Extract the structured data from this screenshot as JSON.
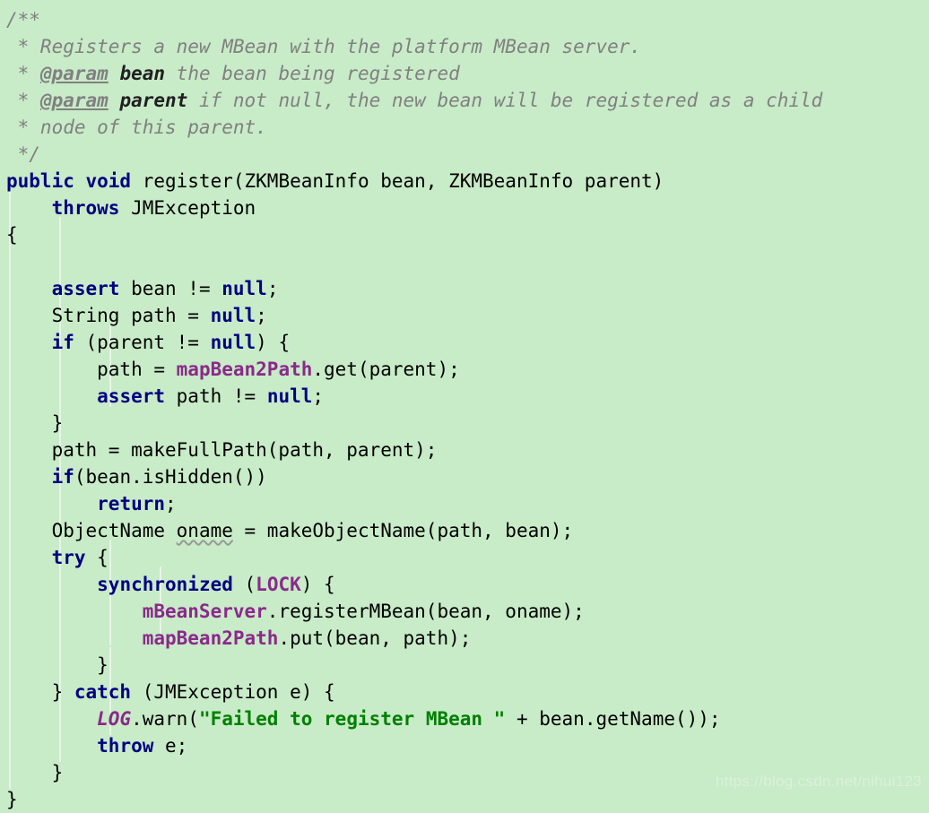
{
  "editor": {
    "background_color": "#c8ebc8",
    "language": "java",
    "indent_guide_color": "#e8f4e8",
    "colors": {
      "keyword": "#000080",
      "field": "#8a2a8a",
      "static_field": "#8a2a8a",
      "string": "#008000",
      "comment": "#808080",
      "javadoc_tag": "#808080",
      "plain_text": "#000000",
      "spellcheck_squiggle": "#9a9a9a"
    },
    "indent_guides_x": [
      10,
      66,
      122,
      178
    ],
    "line_count": 24
  },
  "watermark": {
    "text": "https://blog.csdn.net/nihui123"
  },
  "code": {
    "lines": [
      {
        "n": 1,
        "segments": [
          {
            "t": "cmt",
            "v": "/**"
          }
        ]
      },
      {
        "n": 2,
        "segments": [
          {
            "t": "cmt",
            "v": " * Registers a new MBean with the platform MBean server."
          }
        ]
      },
      {
        "n": 3,
        "segments": [
          {
            "t": "cmt",
            "v": " * "
          },
          {
            "t": "tag",
            "v": "@param"
          },
          {
            "t": "cmt",
            "v": " "
          },
          {
            "t": "pnm",
            "v": "bean"
          },
          {
            "t": "cmt",
            "v": " the bean being registered"
          }
        ]
      },
      {
        "n": 4,
        "segments": [
          {
            "t": "cmt",
            "v": " * "
          },
          {
            "t": "tag",
            "v": "@param"
          },
          {
            "t": "cmt",
            "v": " "
          },
          {
            "t": "pnm",
            "v": "parent"
          },
          {
            "t": "cmt",
            "v": " if not null, the new bean will be registered as a child"
          }
        ]
      },
      {
        "n": 5,
        "segments": [
          {
            "t": "cmt",
            "v": " * node of this parent."
          }
        ]
      },
      {
        "n": 6,
        "segments": [
          {
            "t": "cmt",
            "v": " */"
          }
        ]
      },
      {
        "n": 7,
        "segments": [
          {
            "t": "kw",
            "v": "public void"
          },
          {
            "t": "plain",
            "v": " register(ZKMBeanInfo bean, ZKMBeanInfo parent)"
          }
        ]
      },
      {
        "n": 8,
        "segments": [
          {
            "t": "plain",
            "v": "    "
          },
          {
            "t": "kw",
            "v": "throws"
          },
          {
            "t": "plain",
            "v": " JMException"
          }
        ]
      },
      {
        "n": 9,
        "segments": [
          {
            "t": "plain",
            "v": "{"
          }
        ]
      },
      {
        "n": 10,
        "segments": [
          {
            "t": "plain",
            "v": ""
          }
        ]
      },
      {
        "n": 11,
        "segments": [
          {
            "t": "plain",
            "v": "    "
          },
          {
            "t": "kw",
            "v": "assert"
          },
          {
            "t": "plain",
            "v": " bean != "
          },
          {
            "t": "kw",
            "v": "null"
          },
          {
            "t": "plain",
            "v": ";"
          }
        ]
      },
      {
        "n": 12,
        "segments": [
          {
            "t": "plain",
            "v": "    String path = "
          },
          {
            "t": "kw",
            "v": "null"
          },
          {
            "t": "plain",
            "v": ";"
          }
        ]
      },
      {
        "n": 13,
        "segments": [
          {
            "t": "plain",
            "v": "    "
          },
          {
            "t": "kw",
            "v": "if"
          },
          {
            "t": "plain",
            "v": " (parent != "
          },
          {
            "t": "kw",
            "v": "null"
          },
          {
            "t": "plain",
            "v": ") {"
          }
        ]
      },
      {
        "n": 14,
        "segments": [
          {
            "t": "plain",
            "v": "        path = "
          },
          {
            "t": "fld",
            "v": "mapBean2Path"
          },
          {
            "t": "plain",
            "v": ".get(parent);"
          }
        ]
      },
      {
        "n": 15,
        "segments": [
          {
            "t": "plain",
            "v": "        "
          },
          {
            "t": "kw",
            "v": "assert"
          },
          {
            "t": "plain",
            "v": " path != "
          },
          {
            "t": "kw",
            "v": "null"
          },
          {
            "t": "plain",
            "v": ";"
          }
        ]
      },
      {
        "n": 16,
        "segments": [
          {
            "t": "plain",
            "v": "    }"
          }
        ]
      },
      {
        "n": 17,
        "segments": [
          {
            "t": "plain",
            "v": "    path = makeFullPath(path, parent);"
          }
        ]
      },
      {
        "n": 18,
        "segments": [
          {
            "t": "plain",
            "v": "    "
          },
          {
            "t": "kw",
            "v": "if"
          },
          {
            "t": "plain",
            "v": "(bean.isHidden())"
          }
        ]
      },
      {
        "n": 19,
        "segments": [
          {
            "t": "plain",
            "v": "        "
          },
          {
            "t": "kw",
            "v": "return"
          },
          {
            "t": "plain",
            "v": ";"
          }
        ]
      },
      {
        "n": 20,
        "segments": [
          {
            "t": "plain",
            "v": "    ObjectName "
          },
          {
            "t": "squig",
            "v": "oname"
          },
          {
            "t": "plain",
            "v": " = makeObjectName(path, bean);"
          }
        ]
      },
      {
        "n": 21,
        "segments": [
          {
            "t": "plain",
            "v": "    "
          },
          {
            "t": "kw",
            "v": "try"
          },
          {
            "t": "plain",
            "v": " {"
          }
        ]
      },
      {
        "n": 22,
        "segments": [
          {
            "t": "plain",
            "v": "        "
          },
          {
            "t": "kw",
            "v": "synchronized"
          },
          {
            "t": "plain",
            "v": " ("
          },
          {
            "t": "fld",
            "v": "LOCK"
          },
          {
            "t": "plain",
            "v": ") {"
          }
        ]
      },
      {
        "n": 23,
        "segments": [
          {
            "t": "plain",
            "v": "            "
          },
          {
            "t": "fld",
            "v": "mBeanServer"
          },
          {
            "t": "plain",
            "v": ".registerMBean(bean, oname);"
          }
        ]
      },
      {
        "n": 24,
        "segments": [
          {
            "t": "plain",
            "v": "            "
          },
          {
            "t": "fld",
            "v": "mapBean2Path"
          },
          {
            "t": "plain",
            "v": ".put(bean, path);"
          }
        ]
      },
      {
        "n": 25,
        "segments": [
          {
            "t": "plain",
            "v": "        }"
          }
        ]
      },
      {
        "n": 26,
        "segments": [
          {
            "t": "plain",
            "v": "    } "
          },
          {
            "t": "kw",
            "v": "catch"
          },
          {
            "t": "plain",
            "v": " (JMException e) {"
          }
        ]
      },
      {
        "n": 27,
        "segments": [
          {
            "t": "plain",
            "v": "        "
          },
          {
            "t": "stat",
            "v": "LOG"
          },
          {
            "t": "plain",
            "v": ".warn("
          },
          {
            "t": "str",
            "v": "\"Failed to register MBean \""
          },
          {
            "t": "plain",
            "v": " + bean.getName());"
          }
        ]
      },
      {
        "n": 28,
        "segments": [
          {
            "t": "plain",
            "v": "        "
          },
          {
            "t": "kw",
            "v": "throw"
          },
          {
            "t": "plain",
            "v": " e;"
          }
        ]
      },
      {
        "n": 29,
        "segments": [
          {
            "t": "plain",
            "v": "    }"
          }
        ]
      },
      {
        "n": 30,
        "segments": [
          {
            "t": "plain",
            "v": "}"
          }
        ]
      }
    ]
  }
}
